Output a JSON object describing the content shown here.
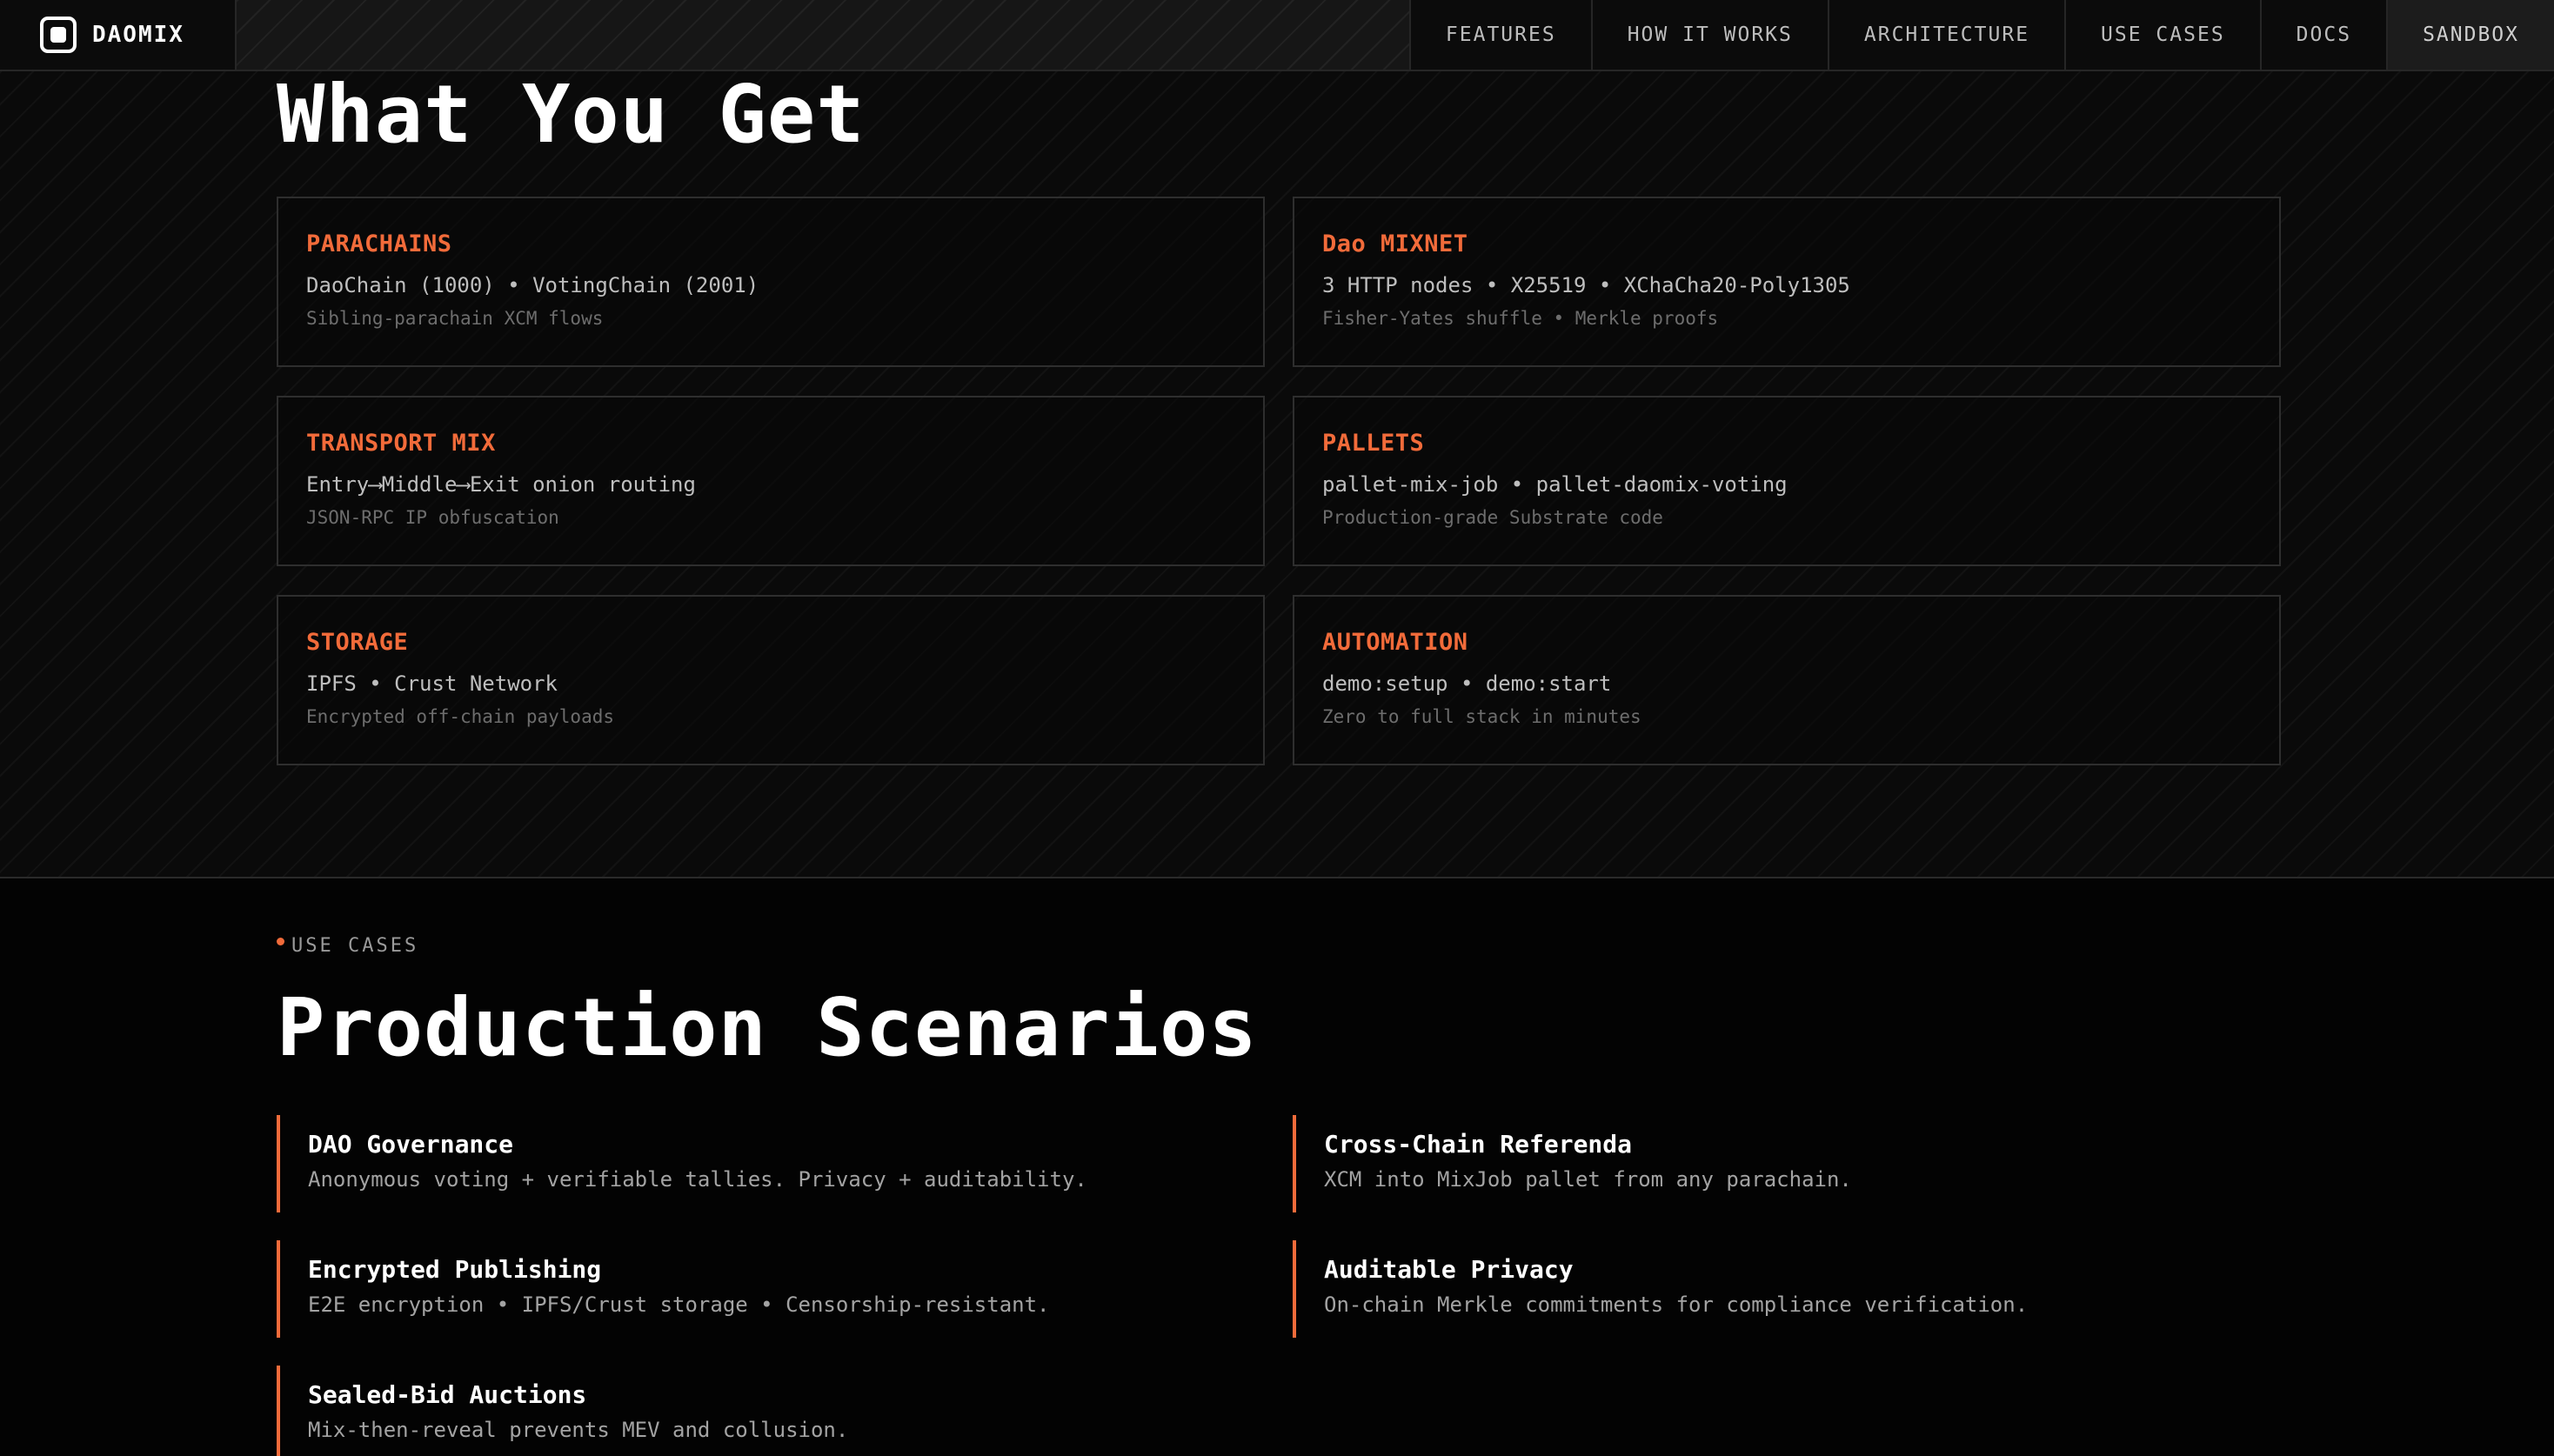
{
  "brand": {
    "name": "DAOMIX"
  },
  "nav": {
    "links": [
      {
        "label": "FEATURES"
      },
      {
        "label": "HOW IT WORKS"
      },
      {
        "label": "ARCHITECTURE"
      },
      {
        "label": "USE CASES"
      },
      {
        "label": "DOCS"
      },
      {
        "label": "SANDBOX"
      }
    ],
    "active": "SANDBOX"
  },
  "features": {
    "title": "What You Get",
    "cards": [
      {
        "title": "PARACHAINS",
        "line": "DaoChain (1000) • VotingChain (2001)",
        "sub": "Sibling-parachain XCM flows"
      },
      {
        "title": "Dao MIXNET",
        "line": "3 HTTP nodes • X25519 • XChaCha20-Poly1305",
        "sub": "Fisher-Yates shuffle • Merkle proofs"
      },
      {
        "title": "TRANSPORT MIX",
        "line": "Entry⟶Middle⟶Exit onion routing",
        "sub": "JSON-RPC IP obfuscation"
      },
      {
        "title": "PALLETS",
        "line": "pallet-mix-job • pallet-daomix-voting",
        "sub": "Production-grade Substrate code"
      },
      {
        "title": "STORAGE",
        "line": "IPFS • Crust Network",
        "sub": "Encrypted off-chain payloads"
      },
      {
        "title": "AUTOMATION",
        "line": "demo:setup • demo:start",
        "sub": "Zero to full stack in minutes"
      }
    ]
  },
  "usecases": {
    "eyebrow": "USE CASES",
    "title": "Production Scenarios",
    "items": [
      {
        "title": "DAO Governance",
        "desc": "Anonymous voting + verifiable tallies. Privacy + auditability."
      },
      {
        "title": "Cross-Chain Referenda",
        "desc": "XCM into MixJob pallet from any parachain."
      },
      {
        "title": "Encrypted Publishing",
        "desc": "E2E encryption • IPFS/Crust storage • Censorship-resistant."
      },
      {
        "title": "Auditable Privacy",
        "desc": "On-chain Merkle commitments for compliance verification."
      },
      {
        "title": "Sealed-Bid Auctions",
        "desc": "Mix-then-reveal prevents MEV and collusion."
      }
    ]
  },
  "colors": {
    "accent": "#f26b3a",
    "background": "#060606",
    "text": "#ffffff",
    "muted": "#a3a3a3"
  }
}
